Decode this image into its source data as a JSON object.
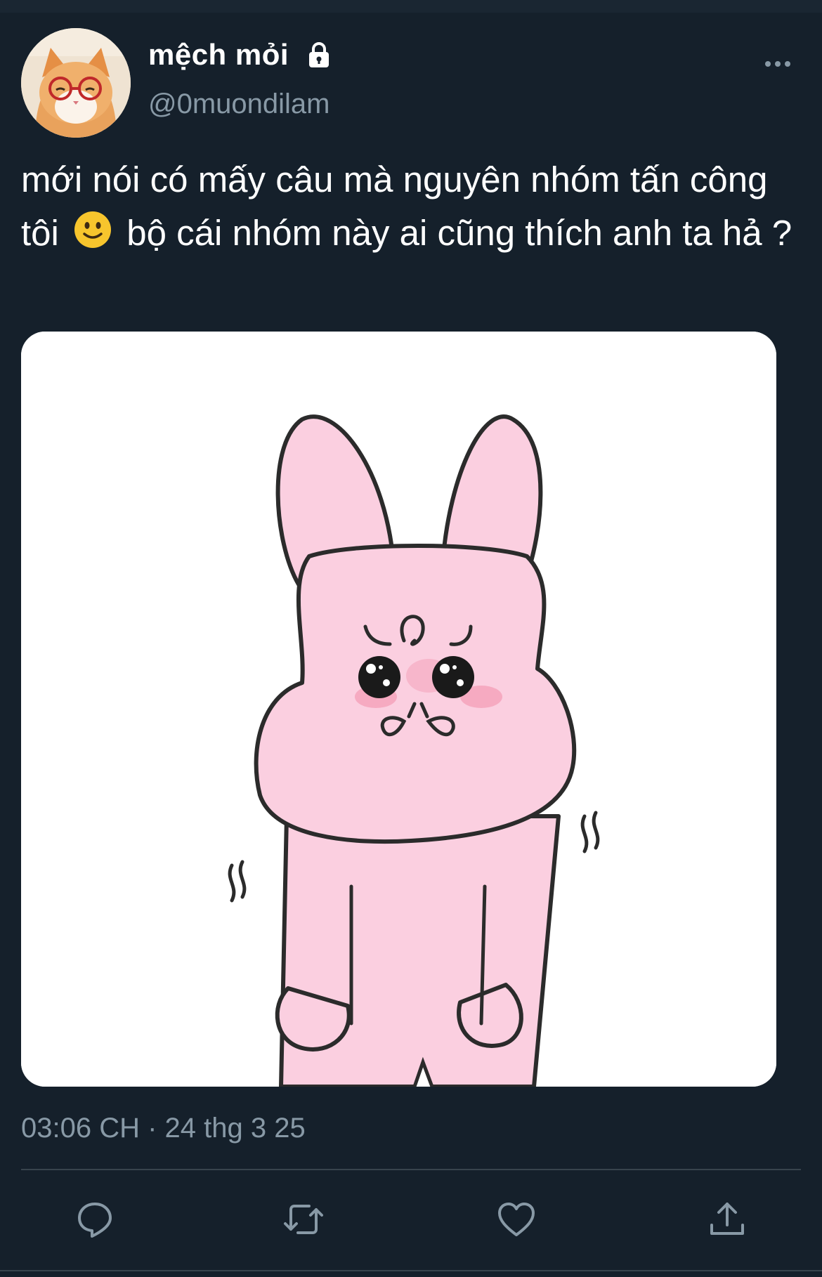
{
  "tweet": {
    "display_name": "mệch mỏi",
    "handle": "@0muondilam",
    "text_part1": "mới nói có mấy câu mà nguyên nhóm tấn công tôi",
    "text_part2": "bộ cái nhóm này ai cũng thích anh ta hả ?",
    "timestamp": "03:06 CH · 24 thg 3 25",
    "protected": true,
    "icons": {
      "lock": "lock-icon",
      "more": "more-icon",
      "emoji": "slightly-smiling-face-emoji",
      "reply": "reply-icon",
      "retweet": "retweet-icon",
      "like": "heart-icon",
      "share": "share-icon"
    }
  },
  "colors": {
    "background": "#15202b",
    "secondary_text": "#8899a6",
    "divider": "#38444d",
    "rabbit_pink": "#fbcfe0"
  }
}
